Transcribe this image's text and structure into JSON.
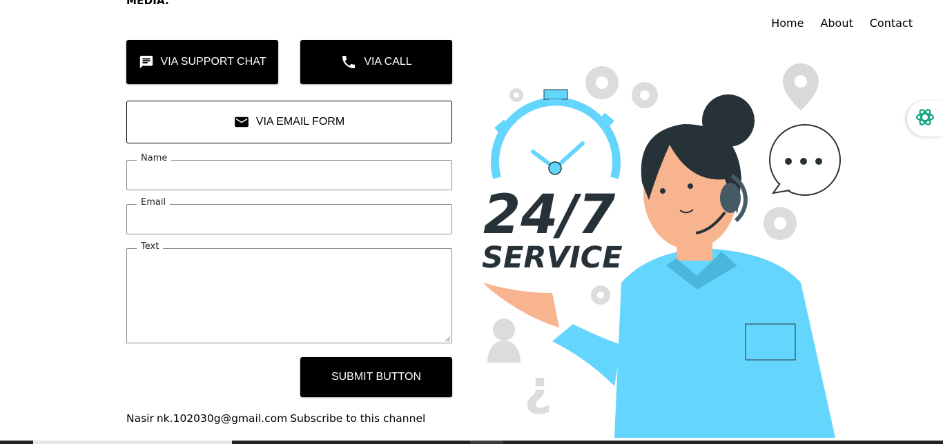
{
  "header": {
    "top_text": "MEDIA."
  },
  "nav": {
    "home": "Home",
    "about": "About",
    "contact": "Contact"
  },
  "contact_options": {
    "support_chat": "VIA SUPPORT CHAT",
    "call": "VIA CALL",
    "email_form": "VIA EMAIL FORM"
  },
  "form": {
    "name_label": "Name",
    "email_label": "Email",
    "text_label": "Text",
    "submit_label": "SUBMIT BUTTON"
  },
  "footer": {
    "name": "Nasir",
    "email": "nk.102030g@gmail.com",
    "subscribe": "Subscribe to this channel"
  },
  "illustration": {
    "big_text": "24/7",
    "service_text": "SERVICE"
  },
  "colors": {
    "accent": "#64d5fc",
    "dark": "#263238",
    "skin": "#f7b48f",
    "widget": "#10a37f"
  },
  "icons": [
    "chat-icon",
    "phone-icon",
    "mail-icon",
    "openai-logo-icon"
  ]
}
